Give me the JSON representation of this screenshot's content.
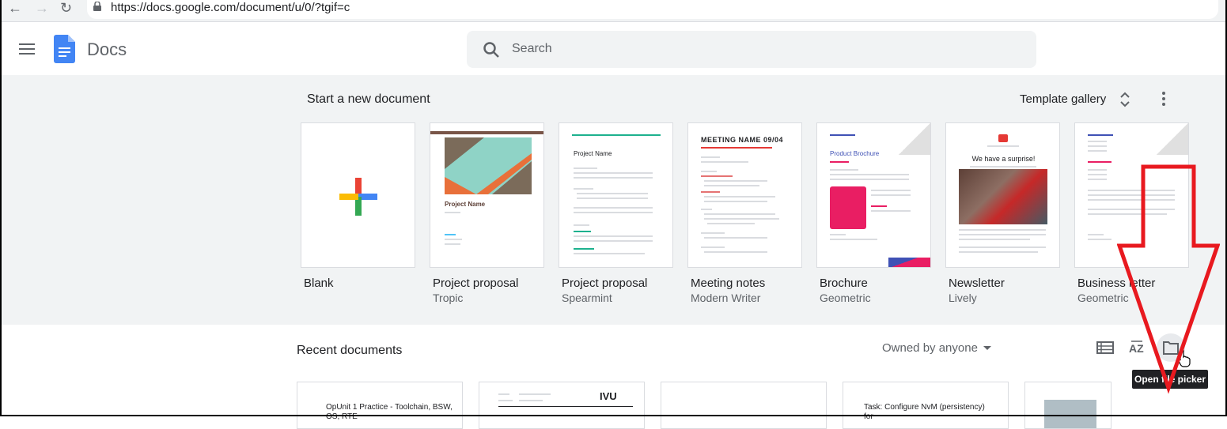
{
  "browser": {
    "url": "https://docs.google.com/document/u/0/?tgif=c"
  },
  "header": {
    "app_name": "Docs",
    "search_placeholder": "Search"
  },
  "templates": {
    "title": "Start a new document",
    "gallery_label": "Template gallery",
    "items": [
      {
        "name": "Blank",
        "sub": ""
      },
      {
        "name": "Project proposal",
        "sub": "Tropic",
        "preview_title": "Project Name"
      },
      {
        "name": "Project proposal",
        "sub": "Spearmint",
        "preview_title": "Project Name"
      },
      {
        "name": "Meeting notes",
        "sub": "Modern Writer",
        "preview_title": "MEETING NAME 09/04"
      },
      {
        "name": "Brochure",
        "sub": "Geometric",
        "preview_title": "Product Brochure"
      },
      {
        "name": "Newsletter",
        "sub": "Lively",
        "preview_title": "We have a surprise!"
      },
      {
        "name": "Business letter",
        "sub": "Geometric"
      }
    ]
  },
  "recent": {
    "title": "Recent documents",
    "owner_filter": "Owned by anyone",
    "tooltip": "Open file picker",
    "docs": [
      {
        "text": "OpUnit 1 Practice - Toolchain, BSW, OS, RTE"
      },
      {
        "text": "IVU"
      },
      {
        "text": ""
      },
      {
        "text": "Task: Configure NvM (persistency) for"
      },
      {
        "text": ""
      }
    ]
  },
  "colors": {
    "docs_blue": "#4285f4",
    "annotation_red": "#e8191f",
    "tooltip_bg": "#202124"
  },
  "icons": [
    "back-icon",
    "forward-icon",
    "reload-icon",
    "lock-icon",
    "menu-icon",
    "docs-logo-icon",
    "search-icon",
    "sort-arrows-icon",
    "more-icon",
    "plus-icon",
    "list-view-icon",
    "sort-az-icon",
    "folder-icon",
    "cursor-hand-icon",
    "red-arrow-annotation"
  ]
}
